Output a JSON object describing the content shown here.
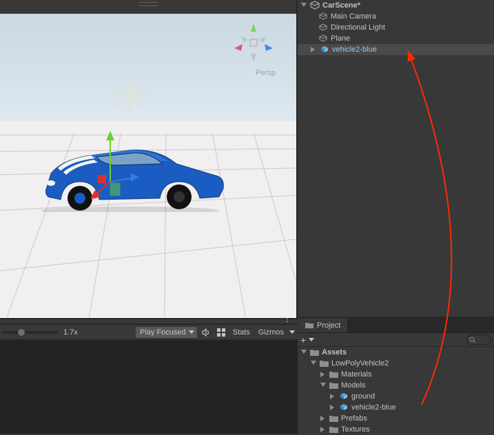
{
  "hierarchy": {
    "scene_name": "CarScene*",
    "items": [
      {
        "label": "Main Camera"
      },
      {
        "label": "Directional Light"
      },
      {
        "label": "Plane"
      },
      {
        "label": "vehicle2-blue"
      }
    ]
  },
  "scene": {
    "persp_label": "Persp"
  },
  "toolbar": {
    "zoom_label": "1.7x",
    "play_mode": "Play Focused",
    "stats_label": "Stats",
    "gizmos_label": "Gizmos"
  },
  "project": {
    "tab_label": "Project",
    "assets_label": "Assets",
    "folders": {
      "lowpoly": "LowPolyVehicle2",
      "materials": "Materials",
      "models": "Models",
      "ground": "ground",
      "vehicle2": "vehicle2-blue",
      "prefabs": "Prefabs",
      "textures": "Textures"
    }
  }
}
